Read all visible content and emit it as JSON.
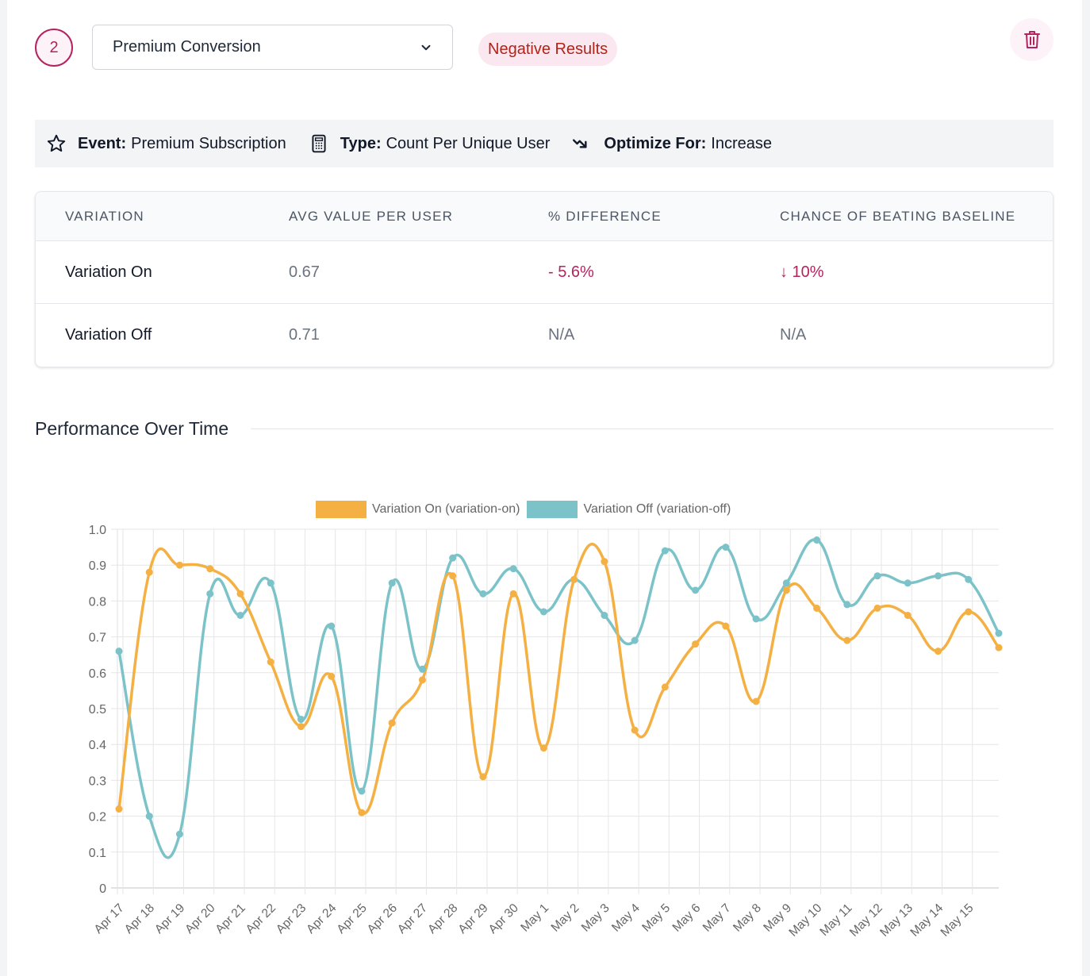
{
  "header": {
    "step_number": "2",
    "metric_select_value": "Premium Conversion",
    "status_badge": "Negative Results",
    "delete_icon": "trash-icon"
  },
  "meta": {
    "event_label": "Event:",
    "event_value": "Premium Subscription",
    "event_icon": "star-icon",
    "type_label": "Type:",
    "type_value": "Count Per Unique User",
    "type_icon": "calculator-icon",
    "optimize_label": "Optimize For:",
    "optimize_value": "Increase",
    "optimize_icon": "trend-arrow-icon"
  },
  "table": {
    "headers": [
      "VARIATION",
      "AVG VALUE PER USER",
      "% DIFFERENCE",
      "CHANCE OF BEATING BASELINE"
    ],
    "rows": [
      {
        "variation": "Variation On",
        "avg": "0.67",
        "diff": "- 5.6%",
        "chance": "↓ 10%"
      },
      {
        "variation": "Variation Off",
        "avg": "0.71",
        "diff": "N/A",
        "chance": "N/A"
      }
    ]
  },
  "section": {
    "title": "Performance Over Time"
  },
  "colors": {
    "accent": "#b3245f",
    "badge_text": "#b42318",
    "series_on": "#f4b042",
    "series_off": "#7cc3c9"
  },
  "chart_data": {
    "type": "line",
    "title": "",
    "xlabel": "",
    "ylabel": "",
    "ylim": [
      0,
      1.0
    ],
    "yticks": [
      "0",
      "0.1",
      "0.2",
      "0.3",
      "0.4",
      "0.5",
      "0.6",
      "0.7",
      "0.8",
      "0.9",
      "1.0"
    ],
    "grid": true,
    "legend_position": "top-center",
    "x_tick_labels": [
      "Apr 17",
      "Apr 18",
      "Apr 19",
      "Apr 20",
      "Apr 21",
      "Apr 22",
      "Apr 23",
      "Apr 24",
      "Apr 25",
      "Apr 26",
      "Apr 27",
      "Apr 28",
      "Apr 29",
      "Apr 30",
      "May 1",
      "May 2",
      "May 3",
      "May 4",
      "May 5",
      "May 6",
      "May 7",
      "May 8",
      "May 9",
      "May 10",
      "May 11",
      "May 12",
      "May 13",
      "May 14",
      "May 15"
    ],
    "series": [
      {
        "name": "Variation On (variation-on)",
        "color": "#f4b042",
        "values": [
          0.22,
          0.88,
          0.9,
          0.89,
          0.82,
          0.63,
          0.45,
          0.59,
          0.21,
          0.46,
          0.58,
          0.87,
          0.31,
          0.82,
          0.39,
          0.86,
          0.91,
          0.44,
          0.56,
          0.68,
          0.73,
          0.52,
          0.83,
          0.78,
          0.69,
          0.78,
          0.76,
          0.66,
          0.77,
          0.67
        ]
      },
      {
        "name": "Variation Off (variation-off)",
        "color": "#7cc3c9",
        "values": [
          0.66,
          0.2,
          0.15,
          0.82,
          0.76,
          0.85,
          0.47,
          0.73,
          0.27,
          0.85,
          0.61,
          0.92,
          0.82,
          0.89,
          0.77,
          0.86,
          0.76,
          0.69,
          0.94,
          0.83,
          0.95,
          0.75,
          0.85,
          0.97,
          0.79,
          0.87,
          0.85,
          0.87,
          0.86,
          0.71
        ]
      }
    ]
  }
}
